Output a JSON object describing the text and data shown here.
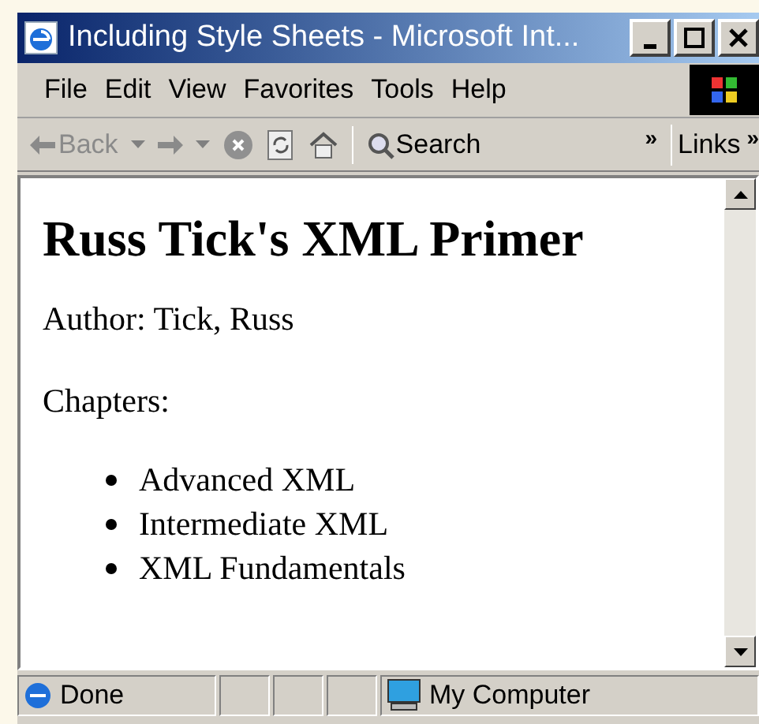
{
  "window": {
    "title": "Including Style Sheets - Microsoft Int..."
  },
  "menu_bar": [
    "File",
    "Edit",
    "View",
    "Favorites",
    "Tools",
    "Help"
  ],
  "toolbar": {
    "back": {
      "label": "Back",
      "disabled": true
    },
    "search": "Search",
    "chevron": "»",
    "links": "Links",
    "links_chevron": "»"
  },
  "document": {
    "heading": "Russ Tick's XML Primer",
    "author": "Author: Tick, Russ",
    "chapters_label": "Chapters:",
    "chapters": [
      "Advanced XML",
      "Intermediate XML",
      "XML Fundamentals"
    ]
  },
  "status_bar": {
    "status": "Done",
    "zone": "My Computer"
  }
}
